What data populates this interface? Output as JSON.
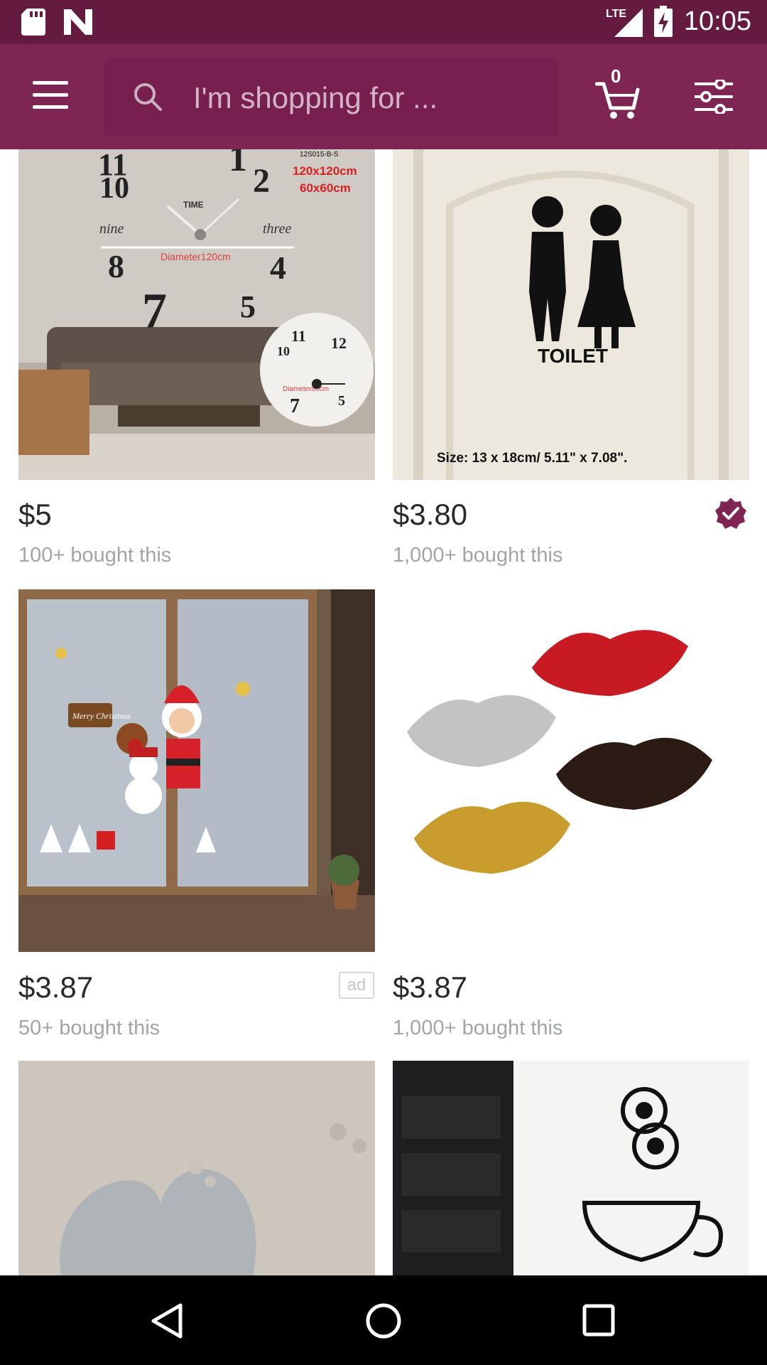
{
  "status_bar": {
    "time": "10:05",
    "network": "LTE",
    "icons": [
      "sd-card-icon",
      "n-logo-icon",
      "signal-icon",
      "battery-charging-icon"
    ]
  },
  "app_bar": {
    "search_placeholder": "I'm shopping for ...",
    "cart_count": "0",
    "icons": [
      "menu-icon",
      "search-icon",
      "cart-icon",
      "filter-icon"
    ]
  },
  "products": [
    {
      "price": "$5",
      "bought": "100+ bought this",
      "image": "diy-wall-clock"
    },
    {
      "price": "$3.80",
      "bought": "1,000+ bought this",
      "image": "toilet-door-sticker",
      "verified": true
    },
    {
      "price": "$3.87",
      "bought": "50+ bought this",
      "image": "christmas-window-stickers",
      "ad_label": "ad"
    },
    {
      "price": "$3.87",
      "bought": "1,000+ bought this",
      "image": "lips-mirror-stickers"
    },
    {
      "image": "heart-mirror-stickers"
    },
    {
      "image": "owl-coffee-cup-decal"
    }
  ],
  "clock_image": {
    "code": "12S015-B-S",
    "sizes": [
      "120x120cm",
      "60x60cm"
    ],
    "word_numbers": [
      "nine",
      "three"
    ],
    "time_label": "TIME",
    "diameter": "Diameter120cm",
    "inset_diameter": "Diameter80cm",
    "digits": [
      "11",
      "1",
      "2",
      "10",
      "8",
      "4",
      "7",
      "5"
    ]
  },
  "toilet_image": {
    "label": "TOILET",
    "size_text": "Size: 13 x 18cm/ 5.11\" x 7.08\"."
  },
  "xmas_image": {
    "sign": "Merry Christmas"
  },
  "colors": {
    "status_bar": "#651a40",
    "app_bar": "#7e2553",
    "accent": "#7e2553",
    "price_text": "#2a2a2a",
    "secondary_text": "#a1a5a8"
  }
}
